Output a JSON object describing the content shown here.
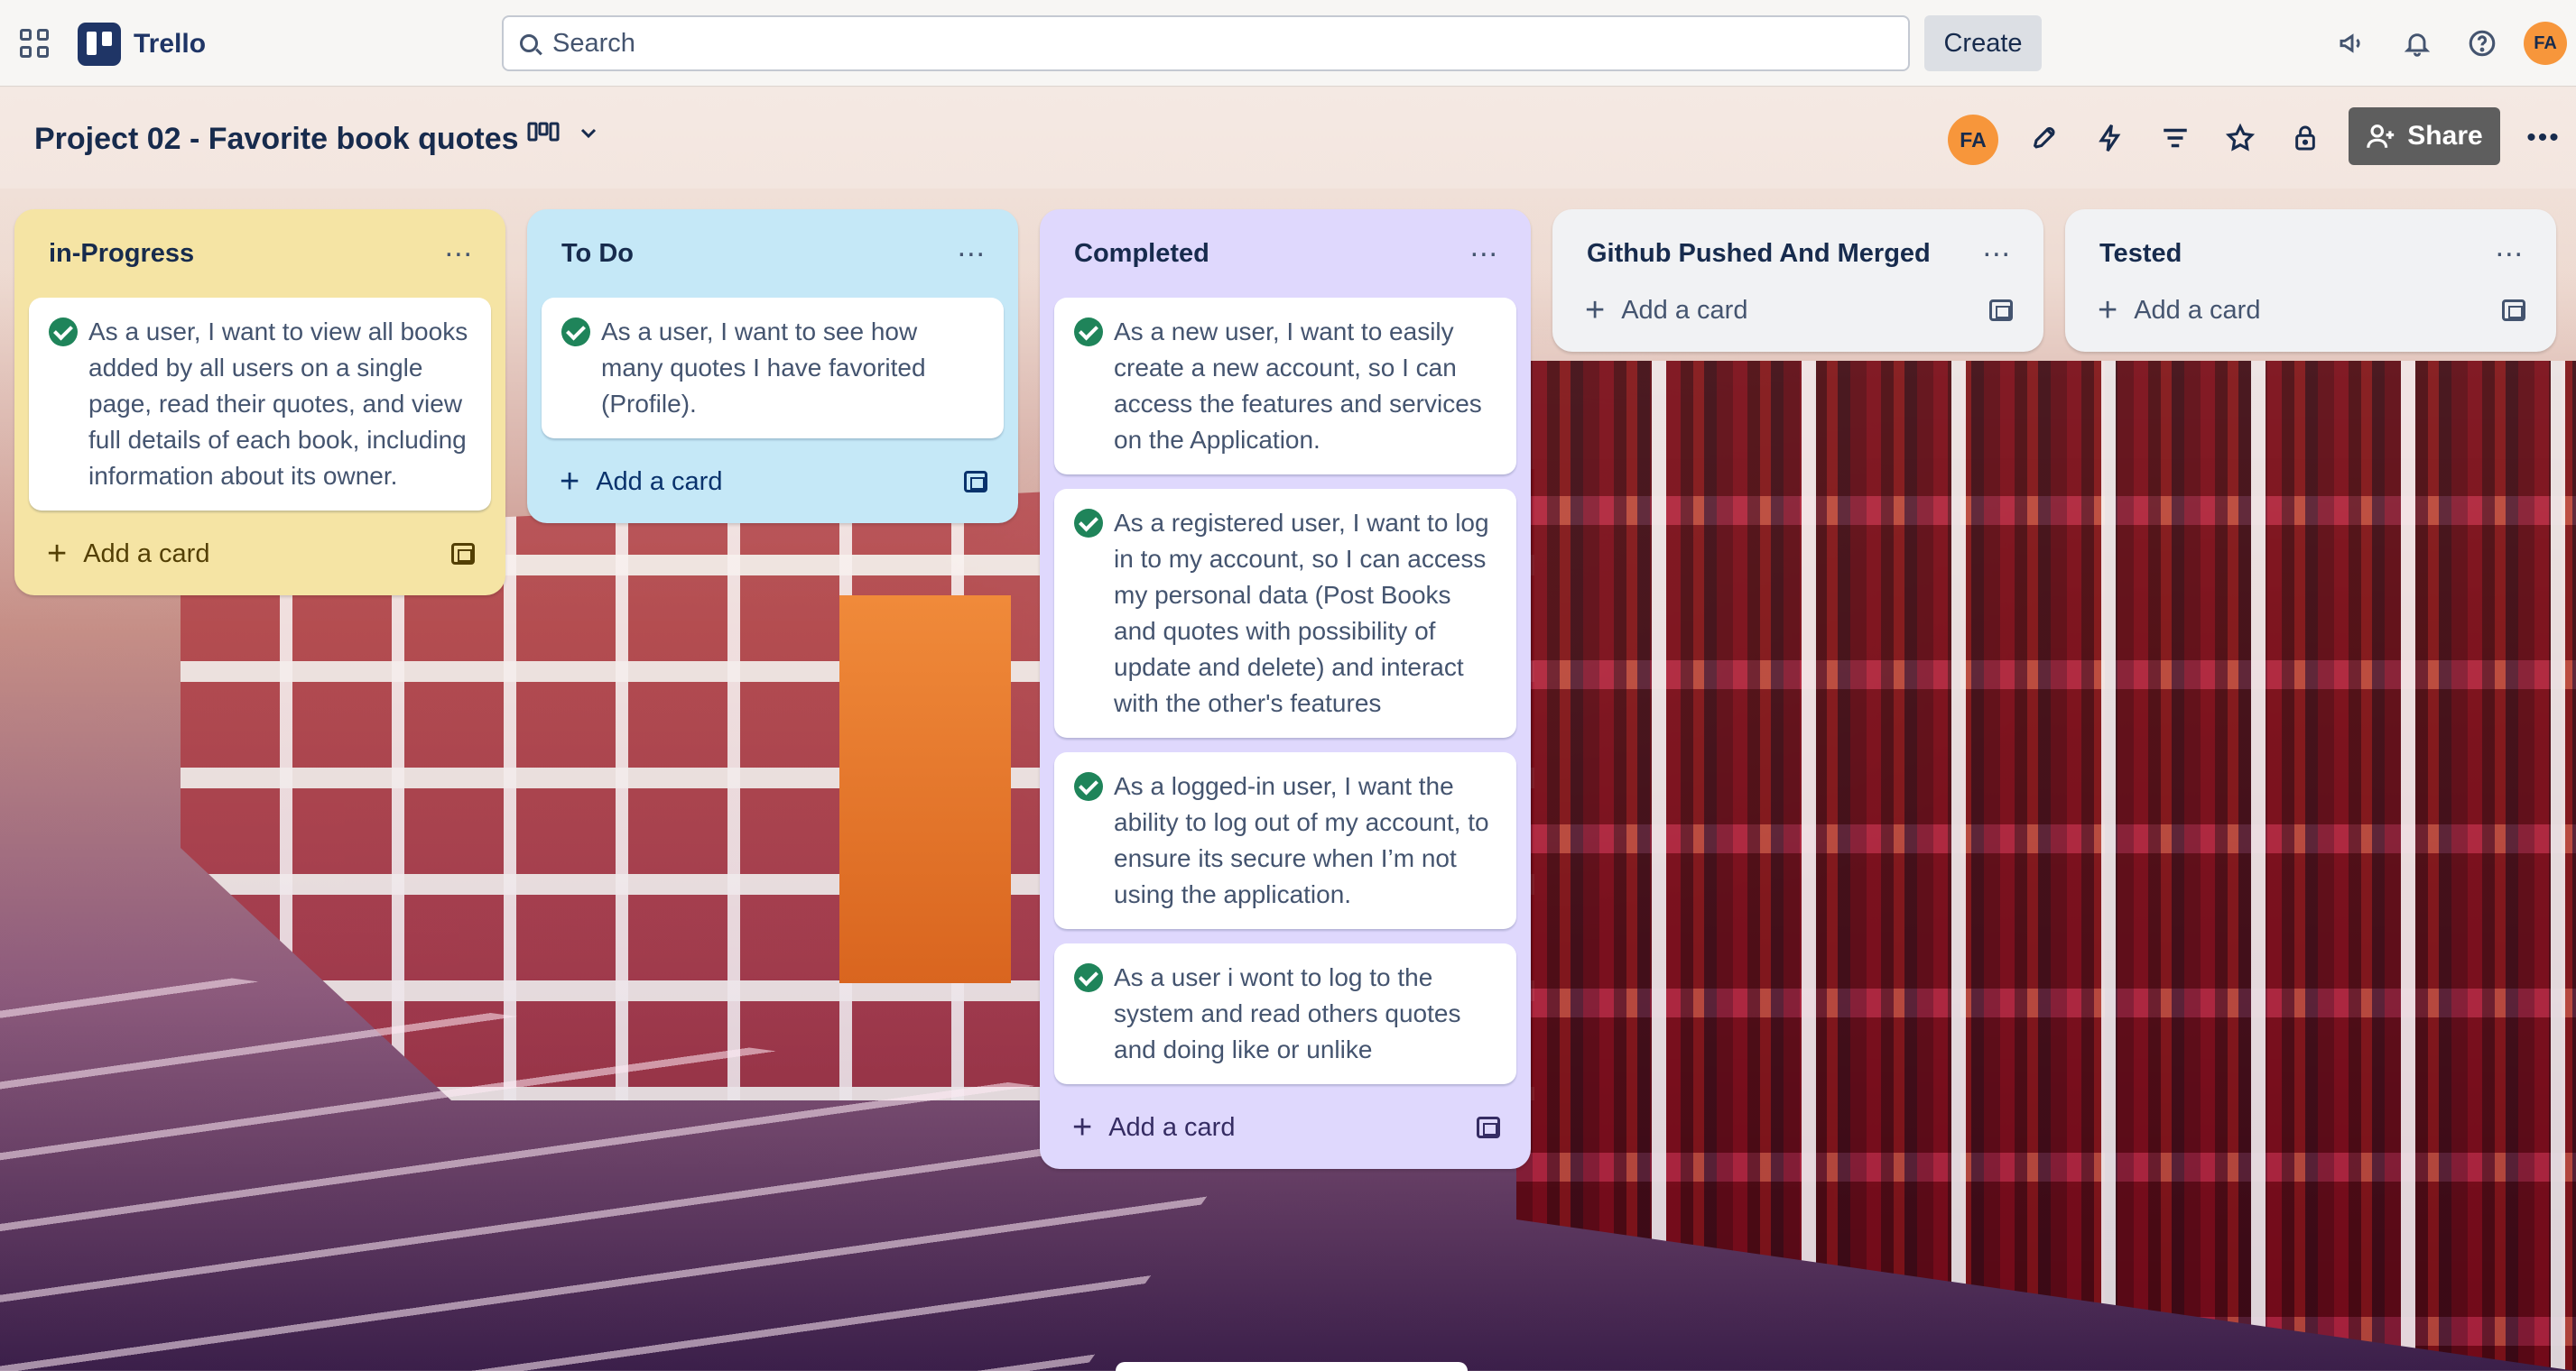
{
  "app": {
    "name": "Trello"
  },
  "topbar": {
    "search_placeholder": "Search",
    "create_label": "Create",
    "user_initials": "FA"
  },
  "board": {
    "title": "Project 02 - Favorite book quotes",
    "member_initials": "FA",
    "share_label": "Share"
  },
  "lists": [
    {
      "title": "in-Progress",
      "add_card_label": "Add a card",
      "cards": [
        {
          "text": "As a user, I want to view all books added by all users on a single page, read their quotes, and view full details of each book, including information about its owner.",
          "completed": true
        }
      ]
    },
    {
      "title": "To Do",
      "add_card_label": "Add a card",
      "cards": [
        {
          "text": "As a user, I want to see how many quotes I have favorited (Profile).",
          "completed": true
        }
      ]
    },
    {
      "title": "Completed",
      "add_card_label": "Add a card",
      "cards": [
        {
          "text": "As a new user, I want to easily create a new account, so I can access the features and services on the Application.",
          "completed": true
        },
        {
          "text": "As a registered user, I want to log in to my account, so I can access my personal data (Post Books and quotes with possibility of update and delete) and interact with the other's features",
          "completed": true
        },
        {
          "text": "As a logged-in user, I want the ability to log out of my account, to ensure its secure when I’m not using the application.",
          "completed": true
        },
        {
          "text": "As a user i wont to log to the system and read others quotes and doing like or unlike",
          "completed": true
        }
      ]
    },
    {
      "title": "Github Pushed And Merged",
      "add_card_label": "Add a card",
      "cards": []
    },
    {
      "title": "Tested",
      "add_card_label": "Add a card",
      "cards": []
    }
  ],
  "colors": {
    "list_in_progress": "#f5e4a4",
    "list_todo": "#c5e8f7",
    "list_completed": "#dfd8fd",
    "list_default": "#f1f2f4",
    "check_green": "#1f845a",
    "avatar_orange": "#f7963b",
    "share_button": "#5e5e5e"
  },
  "icons": [
    "apps-grid-icon",
    "trello-logo-icon",
    "search-icon",
    "megaphone-icon",
    "bell-icon",
    "help-icon",
    "board-view-icon",
    "chevron-down-icon",
    "power-ups-icon",
    "automation-icon",
    "filter-icon",
    "star-icon",
    "lock-icon",
    "add-member-icon",
    "more-icon",
    "check-circle-icon",
    "plus-icon",
    "card-template-icon"
  ]
}
